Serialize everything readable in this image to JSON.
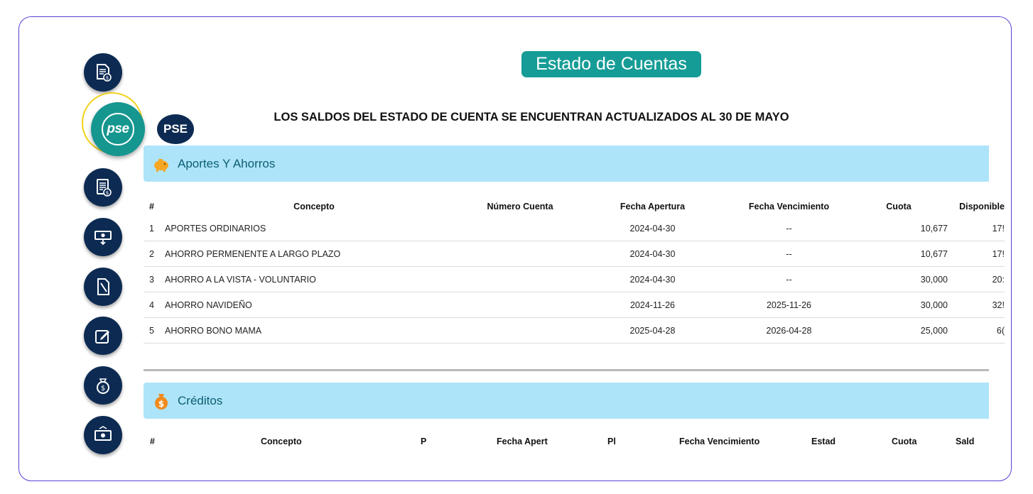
{
  "page": {
    "title": "Estado de Cuentas",
    "notice": "LOS SALDOS DEL ESTADO DE CUENTA SE ENCUENTRAN ACTUALIZADOS AL 30 DE MAYO"
  },
  "sidebar": {
    "pse_label": "PSE",
    "pse_logo_text": "pse",
    "icons": [
      "statement-dollar-icon",
      "pse-logo-icon",
      "invoice-dollar-icon",
      "cash-withdraw-icon",
      "document-icon",
      "edit-icon",
      "money-bag-icon",
      "cash-icon"
    ]
  },
  "aportes": {
    "label": "Aportes Y Ahorros",
    "columns": [
      "#",
      "Concepto",
      "Número Cuenta",
      "Fecha Apertura",
      "Fecha Vencimiento",
      "Cuota",
      "Disponible"
    ],
    "rows": [
      {
        "num": "1",
        "concepto": "APORTES ORDINARIOS",
        "cuenta": "",
        "apertura": "2024-04-30",
        "vencimiento": "--",
        "cuota": "10,677",
        "disponible": "17!"
      },
      {
        "num": "2",
        "concepto": "AHORRO PERMENENTE A LARGO PLAZO",
        "cuenta": "",
        "apertura": "2024-04-30",
        "vencimiento": "--",
        "cuota": "10,677",
        "disponible": "17!"
      },
      {
        "num": "3",
        "concepto": "AHORRO A LA VISTA - VOLUNTARIO",
        "cuenta": "",
        "apertura": "2024-04-30",
        "vencimiento": "--",
        "cuota": "30,000",
        "disponible": "20:"
      },
      {
        "num": "4",
        "concepto": "AHORRO NAVIDEÑO",
        "cuenta": "",
        "apertura": "2024-11-26",
        "vencimiento": "2025-11-26",
        "cuota": "30,000",
        "disponible": "32!"
      },
      {
        "num": "5",
        "concepto": "AHORRO BONO MAMA",
        "cuenta": "",
        "apertura": "2025-04-28",
        "vencimiento": "2026-04-28",
        "cuota": "25,000",
        "disponible": "6("
      }
    ]
  },
  "creditos": {
    "label": "Créditos",
    "columns": [
      "#",
      "Concepto",
      "P",
      "Fecha Apert",
      "Pl",
      "Fecha Vencimiento",
      "Estad",
      "Cuota",
      "Sald"
    ]
  },
  "colors": {
    "accent": "#159c96",
    "navy": "#0d2b52",
    "section_bg": "#aee4f9",
    "highlight_ring": "#f2d21b",
    "frame_border": "#5b3fd6"
  }
}
